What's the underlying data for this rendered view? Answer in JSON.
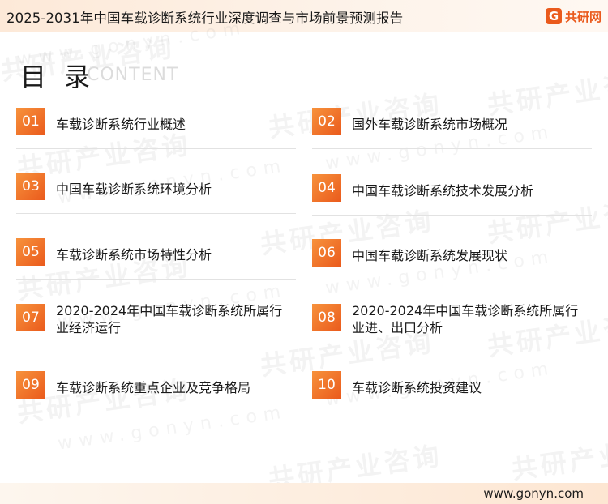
{
  "header": {
    "title": "2025-2031年中国车载诊断系统行业深度调查与市场前景预测报告",
    "brand_mark": "G",
    "brand_name": "共研网"
  },
  "watermark": {
    "text": "共研产业咨询",
    "url": "www.gonyn.com"
  },
  "toc": {
    "heading": "目 录",
    "subheading": "CONTENT",
    "items": [
      {
        "num": "01",
        "label": "车载诊断系统行业概述"
      },
      {
        "num": "02",
        "label": "国外车载诊断系统市场概况"
      },
      {
        "num": "03",
        "label": "中国车载诊断系统环境分析"
      },
      {
        "num": "04",
        "label": "中国车载诊断系统技术发展分析"
      },
      {
        "num": "05",
        "label": "车载诊断系统市场特性分析"
      },
      {
        "num": "06",
        "label": "中国车载诊断系统发展现状"
      },
      {
        "num": "07",
        "label": "2020-2024年中国车载诊断系统所属行业经济运行"
      },
      {
        "num": "08",
        "label": "2020-2024年中国车载诊断系统所属行业进、出口分析"
      },
      {
        "num": "09",
        "label": "车载诊断系统重点企业及竞争格局"
      },
      {
        "num": "10",
        "label": "车载诊断系统投资建议"
      }
    ]
  },
  "footer": {
    "website": "www.gonyn.com"
  },
  "colors": {
    "accent": "#ea5a1c",
    "accent_light": "#f7923c"
  }
}
